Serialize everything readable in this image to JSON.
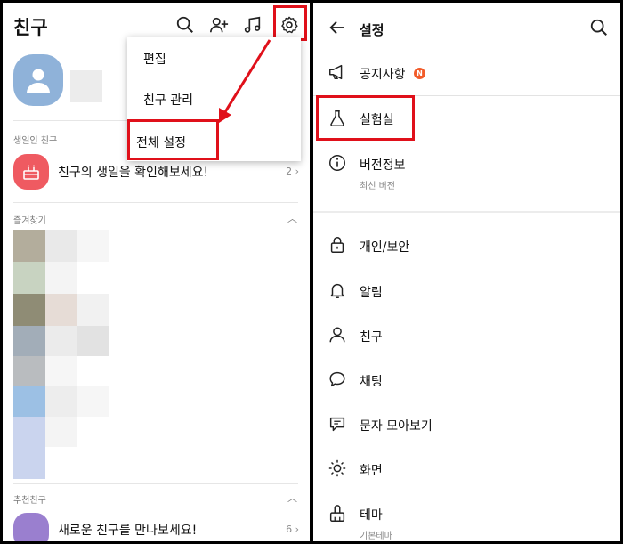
{
  "left": {
    "title": "친구",
    "menu": {
      "items": [
        "편집",
        "친구 관리",
        "전체 설정"
      ]
    },
    "birthday": {
      "section_label": "생일인 친구",
      "text": "친구의 생일을 확인해보세요!",
      "count": "2"
    },
    "favorites": {
      "section_label": "즐겨찾기"
    },
    "recommended": {
      "section_label": "추천친구",
      "text": "새로운 친구를 만나보세요!",
      "count": "6"
    }
  },
  "right": {
    "title": "설정",
    "notice": {
      "label": "공지사항",
      "badge": "N"
    },
    "lab": {
      "label": "실험실"
    },
    "version": {
      "label": "버전정보",
      "sub": "최신 버전"
    },
    "items": [
      "개인/보안",
      "알림",
      "친구",
      "채팅",
      "문자 모아보기",
      "화면",
      "테마"
    ],
    "theme_sub": "기본테마"
  },
  "colors": {
    "highlight": "#e0101a",
    "badge": "#f25c2a",
    "birthday_icon": "#ef5a61",
    "avatar": "#8fb2d9"
  },
  "icons": {
    "left_header": [
      "search-icon",
      "add-friend-icon",
      "music-icon",
      "gear-icon"
    ],
    "right_header": [
      "back-arrow-icon",
      "search-icon"
    ]
  }
}
